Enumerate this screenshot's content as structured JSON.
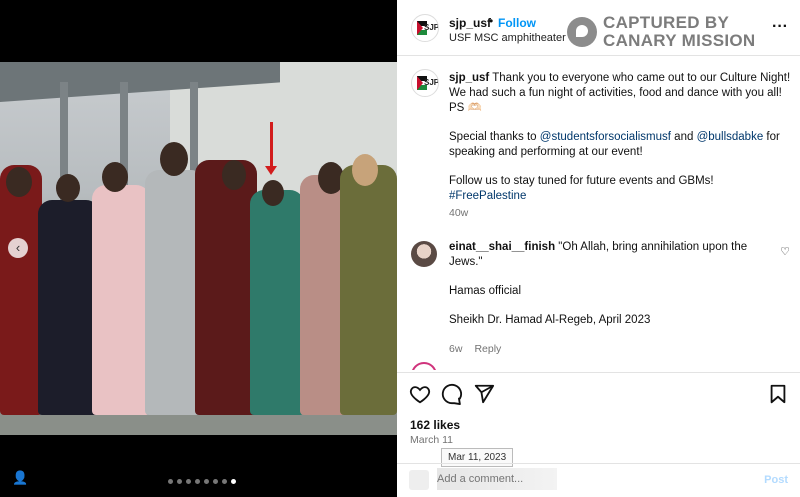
{
  "media": {
    "prev_glyph": "‹",
    "user_tag_glyph": "👤",
    "dot_count": 8,
    "active_dot": 7
  },
  "header": {
    "username": "sjp_usf",
    "separator": "•",
    "follow_label": "Follow",
    "location": "USF MSC amphitheater",
    "avatar_text": "SJP",
    "more_glyph": "···"
  },
  "watermark": {
    "line1": "CAPTURED BY",
    "line2": "CANARY MISSION"
  },
  "caption": {
    "username": "sjp_usf",
    "text1": " Thank you to everyone who came out to our Culture Night! We had such a fun night of activities, food and dance with you all! PS 🫶🏻",
    "text2_pre": "Special thanks to ",
    "mention1": "@studentsforsocialismusf",
    "text2_mid": " and ",
    "mention2": "@bullsdabke",
    "text2_post": " for speaking and performing at our event!",
    "text3": "Follow us to stay tuned for future events and GBMs!",
    "hashtag": "#FreePalestine",
    "time": "40w"
  },
  "comment": {
    "username": "einat__shai__finish",
    "text": " \"Oh Allah, bring annihilation upon the Jews.\"",
    "line2": "Hamas official",
    "line3": "Sheikh Dr. Hamad Al-Regeb, April 2023",
    "time": "6w",
    "reply_label": "Reply",
    "heart_glyph": "♡"
  },
  "actions": {
    "likes": "162 likes",
    "date": "March 11",
    "tooltip": "Mar 11, 2023",
    "post_label": "Post",
    "comment_placeholder": "Add a comment..."
  }
}
